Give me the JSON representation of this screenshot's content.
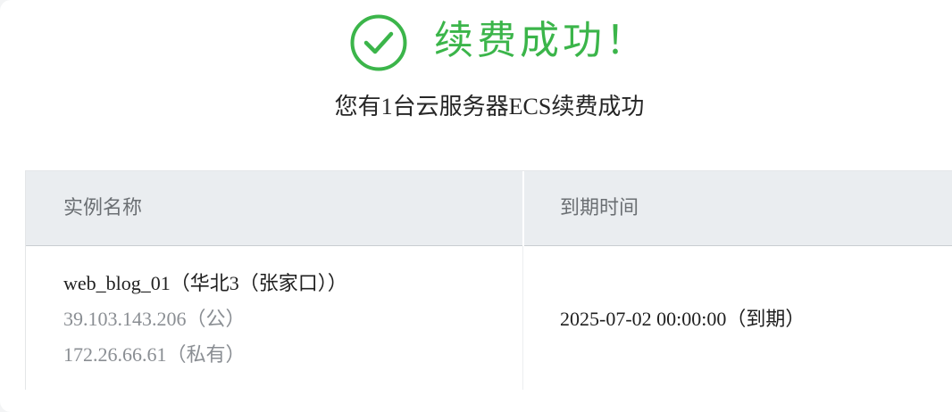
{
  "header": {
    "icon": "check-circle-icon",
    "title": "续费成功！",
    "subtitle": "您有1台云服务器ECS续费成功",
    "accent_color": "#3bb54a"
  },
  "table": {
    "columns": [
      "实例名称",
      "到期时间"
    ],
    "rows": [
      {
        "instance_name": "web_blog_01（华北3（张家口））",
        "public_ip": "39.103.143.206（公）",
        "private_ip": "172.26.66.61（私有）",
        "expire_time": "2025-07-02 00:00:00（到期）"
      }
    ]
  }
}
